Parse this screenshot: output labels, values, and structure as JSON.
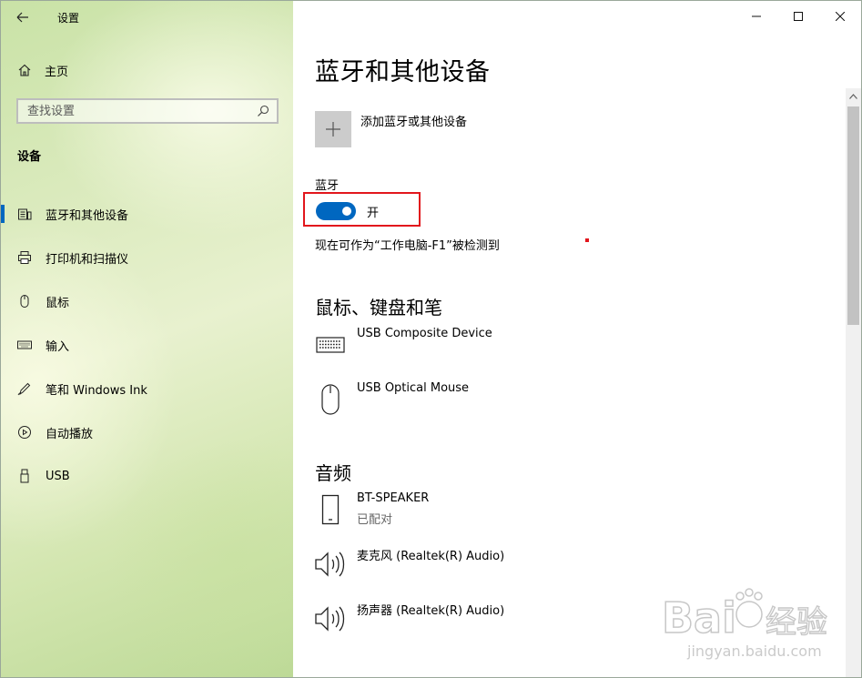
{
  "app": {
    "title": "设置"
  },
  "sidebar": {
    "home_label": "主页",
    "search_placeholder": "查找设置",
    "section_title": "设备",
    "items": [
      {
        "label": "蓝牙和其他设备",
        "icon": "bluetooth-devices-icon",
        "active": true
      },
      {
        "label": "打印机和扫描仪",
        "icon": "printer-icon",
        "active": false
      },
      {
        "label": "鼠标",
        "icon": "mouse-icon",
        "active": false
      },
      {
        "label": "输入",
        "icon": "keyboard-icon",
        "active": false
      },
      {
        "label": "笔和 Windows Ink",
        "icon": "pen-icon",
        "active": false
      },
      {
        "label": "自动播放",
        "icon": "autoplay-icon",
        "active": false
      },
      {
        "label": "USB",
        "icon": "usb-icon",
        "active": false
      }
    ]
  },
  "main": {
    "title": "蓝牙和其他设备",
    "add_device_label": "添加蓝牙或其他设备",
    "bluetooth": {
      "label": "蓝牙",
      "state_text": "开",
      "on": true,
      "discoverable_text": "现在可作为“工作电脑-F1”被检测到"
    },
    "groups": [
      {
        "title": "鼠标、键盘和笔",
        "devices": [
          {
            "name": "USB Composite Device",
            "status": "",
            "icon": "keyboard-icon"
          },
          {
            "name": "USB Optical Mouse",
            "status": "",
            "icon": "mouse-icon"
          }
        ]
      },
      {
        "title": "音频",
        "devices": [
          {
            "name": "BT-SPEAKER",
            "status": "已配对",
            "icon": "phone-icon"
          },
          {
            "name": "麦克风 (Realtek(R) Audio)",
            "status": "",
            "icon": "speaker-icon"
          },
          {
            "name": "扬声器 (Realtek(R) Audio)",
            "status": "",
            "icon": "speaker-icon"
          }
        ]
      }
    ]
  },
  "watermark": {
    "brand": "Bai du 经验",
    "url": "jingyan.baidu.com"
  },
  "colors": {
    "accent": "#0067c0",
    "highlight": "#e2161c",
    "tile": "#cccccc"
  }
}
